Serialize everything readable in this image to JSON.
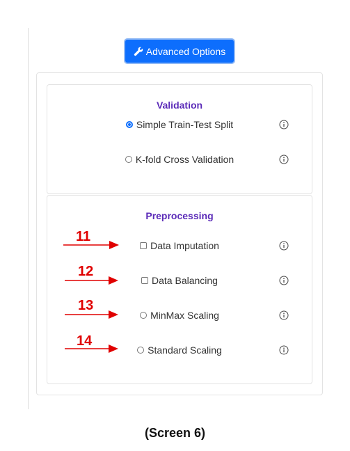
{
  "advanced_button": {
    "label": "Advanced Options",
    "icon": "wrench-icon"
  },
  "validation": {
    "title": "Validation",
    "options": [
      {
        "label": "Simple Train-Test Split",
        "checked": true
      },
      {
        "label": "K-fold Cross Validation",
        "checked": false
      }
    ]
  },
  "preprocessing": {
    "title": "Preprocessing",
    "options": [
      {
        "label": "Data Imputation",
        "control": "checkbox"
      },
      {
        "label": "Data Balancing",
        "control": "checkbox"
      },
      {
        "label": "MinMax Scaling",
        "control": "radio"
      },
      {
        "label": "Standard Scaling",
        "control": "radio"
      }
    ]
  },
  "annotations": [
    "11",
    "12",
    "13",
    "14"
  ],
  "caption": "(Screen 6)",
  "colors": {
    "accent": "#0d6efd",
    "title": "#5b2bb8",
    "annotation": "#e00000"
  }
}
